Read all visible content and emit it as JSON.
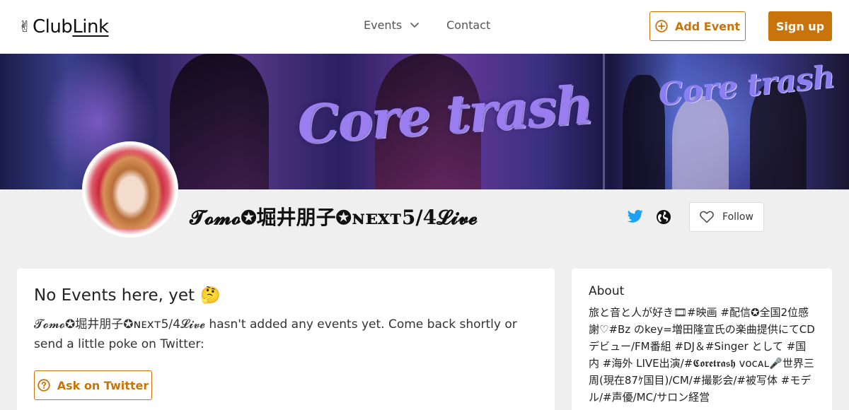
{
  "header": {
    "logo_prefix": "Club",
    "logo_suffix": "Link",
    "logo_icon": "victory-hand-icon",
    "nav_events": "Events",
    "nav_contact": "Contact",
    "add_event": "Add Event",
    "sign_up": "Sign up"
  },
  "banner": {
    "band_logo_text": "Core trash"
  },
  "profile": {
    "name": "𝓣𝓸𝓶𝓸✪堀井朋子✪ɴᴇxᴛ5/4𝓛𝓲𝓿𝓮",
    "follow": "Follow",
    "links": [
      "twitter-icon",
      "globe-icon"
    ]
  },
  "events_card": {
    "title": "No Events here, yet",
    "emoji": "🤔",
    "description": "𝓣𝓸𝓶𝓸✪堀井朋子✪ɴᴇxᴛ5/4𝓛𝓲𝓿𝓮 hasn't added any events yet. Come back shortly or send a little poke on Twitter:",
    "ask_button": "Ask on Twitter"
  },
  "about_card": {
    "title": "About",
    "bio": "旅と音と人が好き🎞#映画 #配信✪全国2位感謝♡#Bz のkey=増田隆宣氏の楽曲提供にてCDデビュー/FM番組 #DJ＆#Singer として #国内 #海外 LIVE出演/#𝕮𝖔𝖗𝖊𝖙𝖗𝖆𝖘𝖍 ᴠᴏᴄᴀʟ🎤世界三周(現在87ｹ国目)/CM/#撮影会/#被写体 #モデル/#声優/MC/サロン経営"
  },
  "colors": {
    "accent": "#c8740a",
    "twitter": "#1da1f2",
    "page_bg": "#efefef"
  }
}
